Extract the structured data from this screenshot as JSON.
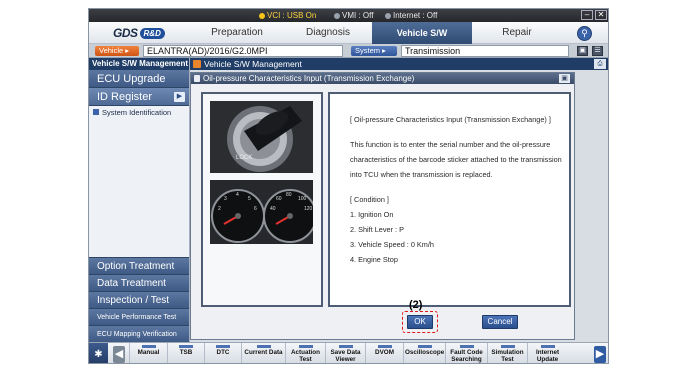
{
  "status": {
    "vci": "VCI : USB On",
    "vmi": "VMI : Off",
    "internet": "Internet : Off",
    "minimize": "–",
    "close": "✕"
  },
  "header": {
    "logo_text": "GDS",
    "logo_badge": "R&D",
    "menu": [
      "Preparation",
      "Diagnosis",
      "Vehicle S/W Management",
      "Repair"
    ],
    "active_menu": "Vehicle S/W Management"
  },
  "vehicle_bar": {
    "vehicle_label": "Vehicle ▸",
    "vehicle_value": "ELANTRA(AD)/2016/G2.0MPI",
    "system_label": "System ▸",
    "system_value": "Transimission"
  },
  "sidebar": {
    "title": "Vehicle S/W Management",
    "items_top": [
      "ECU Upgrade",
      "ID Register"
    ],
    "selected": "ID Register",
    "sub_items": [
      "System Identification"
    ],
    "items_bottom": [
      "Option Treatment",
      "Data Treatment",
      "Inspection / Test",
      "Vehicle Performance Test",
      "ECU Mapping Verification"
    ]
  },
  "main": {
    "title": "Vehicle S/W Management"
  },
  "dialog": {
    "title": "Oil-pressure Characteristics Input (Transmission Exchange)",
    "lines": [
      "[ Oil-pressure Characteristics Input (Transmission Exchange) ]",
      "This function is to enter the serial number and the oil-pressure",
      "characteristics of the barcode sticker attached to the transmission",
      "into TCU when the transmission is replaced."
    ],
    "condition_title": "[ Condition ]",
    "conditions": [
      "1. Ignition On",
      "2. Shift Lever : P",
      "3. Vehicle Speed : 0 Km/h",
      "4. Engine Stop"
    ],
    "ok_label": "OK",
    "cancel_label": "Cancel",
    "callout": "(2)"
  },
  "toolbar": {
    "buttons": [
      "Manual",
      "TSB",
      "DTC",
      "Current Data",
      "Actuation Test",
      "Save Data Viewer",
      "DVOM",
      "Oscilloscope",
      "Fault Code Searching",
      "Simulation Test",
      "Internet Update"
    ]
  },
  "colors": {
    "accent": "#1f3d66",
    "highlight": "#e01818",
    "vehicle_tag": "#e0692a"
  }
}
